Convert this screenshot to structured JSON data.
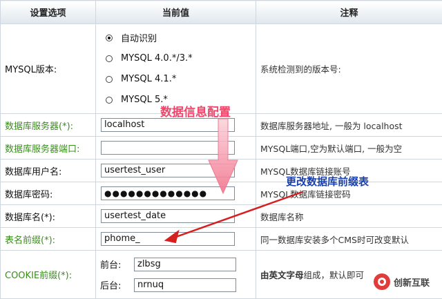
{
  "headers": {
    "option": "设置选项",
    "value": "当前值",
    "note": "注释"
  },
  "mysql_version": {
    "label": "MYSQL版本:",
    "options": [
      "自动识别",
      "MYSQL 4.0.*/3.*",
      "MYSQL 4.1.*",
      "MYSQL 5.*"
    ],
    "selected": 0,
    "note": "系统检测到的版本号:"
  },
  "rows": [
    {
      "label": "数据库服务器(*):",
      "value": "localhost",
      "note": "数据库服务器地址, 一般为 localhost",
      "green": true
    },
    {
      "label": "数据库服务器端口:",
      "value": "",
      "note": "MYSQL端口,空为默认端口, 一般为空",
      "green": true
    },
    {
      "label": "数据库用户名:",
      "value": "usertest_user",
      "note": "MYSQL数据库链接账号",
      "green": false
    },
    {
      "label": "数据库密码:",
      "value": "●●●●●●●●●●●●●",
      "note": "MYSQL数据库链接密码",
      "green": false
    },
    {
      "label": "数据库名(*):",
      "value": "usertest_date",
      "note": "数据库名称",
      "green": false
    },
    {
      "label": "表名前缀(*):",
      "value": "phome_",
      "note": "同一数据库安装多个CMS时可改变默认",
      "green": true
    }
  ],
  "cookie": {
    "label": "COOKIE前缀(*):",
    "front_label": "前台:",
    "front_value": "zlbsg",
    "back_label": "后台:",
    "back_value": "nrnuq",
    "note_bold": "由英文字母",
    "note_rest": "组成，默认即可"
  },
  "annotations": {
    "db_config": "数据信息配置",
    "prefix_change": "更改数据库前缀表"
  },
  "watermark": {
    "text": "创新互联"
  },
  "colors": {
    "green_label": "#3a8c1e",
    "pink_annotation": "#f0466b",
    "blue_annotation": "#1a3fa8",
    "red_arrow": "#d62020"
  }
}
